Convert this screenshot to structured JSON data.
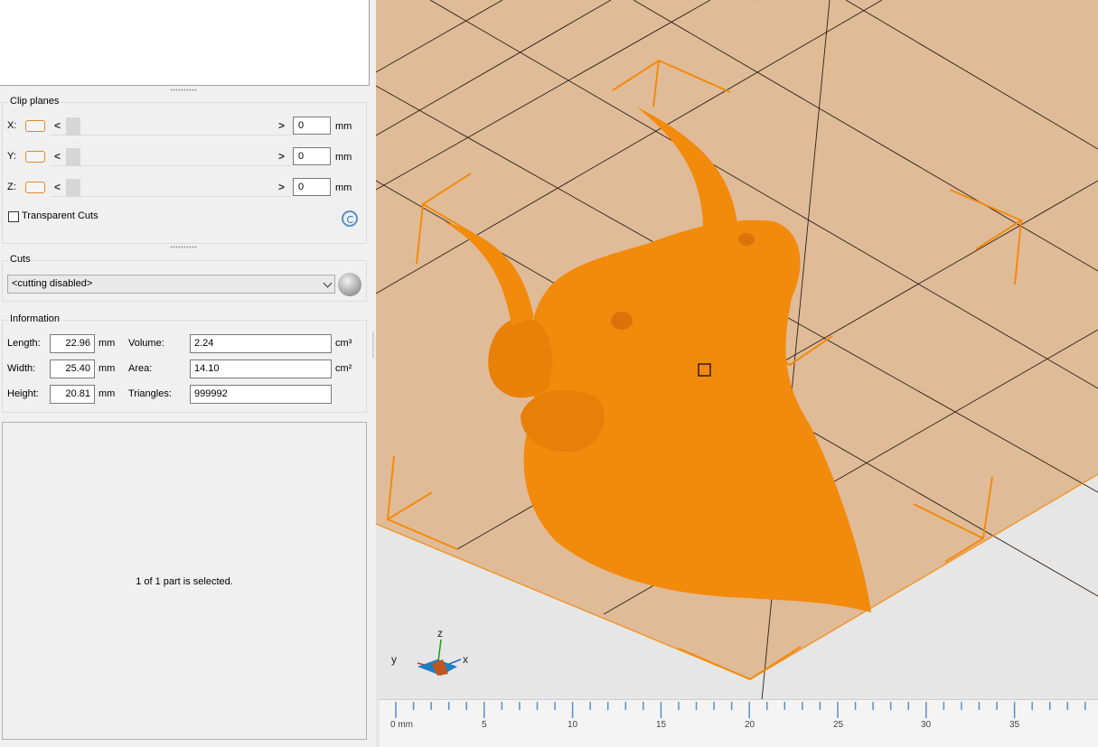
{
  "clip_planes": {
    "title": "Clip planes",
    "axes": [
      {
        "label": "X:",
        "value": "0",
        "unit": "mm"
      },
      {
        "label": "Y:",
        "value": "0",
        "unit": "mm"
      },
      {
        "label": "Z:",
        "value": "0",
        "unit": "mm"
      }
    ],
    "prev_glyph": "<",
    "next_glyph": ">",
    "transparent_cuts_label": "Transparent Cuts",
    "transparent_cuts_checked": false
  },
  "cuts": {
    "title": "Cuts",
    "selected": "<cutting disabled>"
  },
  "information": {
    "title": "Information",
    "length": {
      "label": "Length:",
      "value": "22.96",
      "unit": "mm"
    },
    "width": {
      "label": "Width:",
      "value": "25.40",
      "unit": "mm"
    },
    "height": {
      "label": "Height:",
      "value": "20.81",
      "unit": "mm"
    },
    "volume": {
      "label": "Volume:",
      "value": "2.24",
      "unit": "cm³"
    },
    "area": {
      "label": "Area:",
      "value": "14.10",
      "unit": "cm²"
    },
    "triangles": {
      "label": "Triangles:",
      "value": "999992"
    }
  },
  "selection_status": "1 of 1 part is selected.",
  "viewport": {
    "axes": {
      "z": "z",
      "y": "y",
      "x": "x"
    },
    "ruler_labels": [
      "0 mm",
      "5",
      "10",
      "15",
      "20",
      "25",
      "30",
      "35"
    ],
    "colors": {
      "bed": "#e0bb98",
      "model": "#f28a0c",
      "bbox": "#f28a0c",
      "background": "#e6e6e6"
    }
  }
}
